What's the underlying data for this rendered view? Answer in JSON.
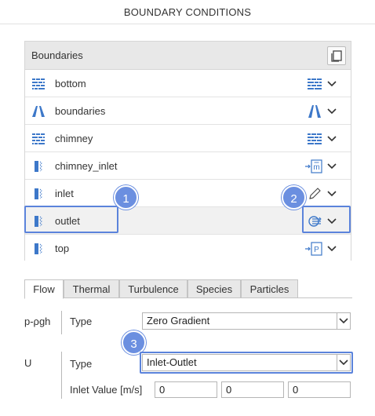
{
  "panel_title": "BOUNDARY CONDITIONS",
  "boundaries": {
    "header": "Boundaries",
    "items": [
      {
        "name": "bottom",
        "type_icon": "wall-icon",
        "cond_icon": "wall-icon"
      },
      {
        "name": "boundaries",
        "type_icon": "symmetry-icon",
        "cond_icon": "symmetry-icon"
      },
      {
        "name": "chimney",
        "type_icon": "wall-icon",
        "cond_icon": "wall-icon"
      },
      {
        "name": "chimney_inlet",
        "type_icon": "patch-icon",
        "cond_icon": "mass-flow-inlet-icon"
      },
      {
        "name": "inlet",
        "type_icon": "patch-icon",
        "cond_icon": "pencil-icon"
      },
      {
        "name": "outlet",
        "type_icon": "patch-icon",
        "cond_icon": "outflow-icon"
      },
      {
        "name": "top",
        "type_icon": "patch-icon",
        "cond_icon": "pressure-inlet-icon"
      }
    ]
  },
  "badges": [
    "1",
    "2",
    "3"
  ],
  "tabs": [
    "Flow",
    "Thermal",
    "Turbulence",
    "Species",
    "Particles"
  ],
  "active_tab": "Flow",
  "fields": {
    "p_rgh": {
      "label": "p-ρgh",
      "type_label": "Type",
      "type_value": "Zero Gradient"
    },
    "U": {
      "label": "U",
      "type_label": "Type",
      "type_value": "Inlet-Outlet",
      "inlet_label": "Inlet Value [m/s]",
      "inlet_values": [
        "0",
        "0",
        "0"
      ]
    }
  },
  "colors": {
    "accent": "#5b83db",
    "badge": "#6b8fe0",
    "icon_blue": "#3d78c9"
  }
}
